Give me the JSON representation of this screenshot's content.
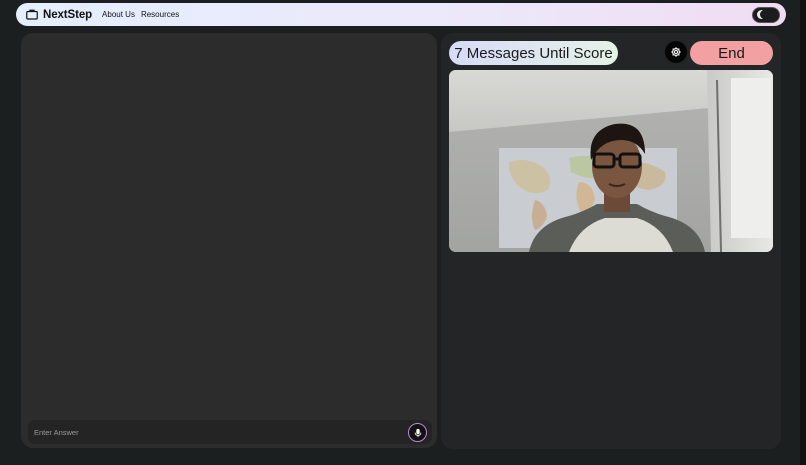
{
  "nav": {
    "brand": "NextStep",
    "brand_icon": "briefcase-icon",
    "links": [
      "About Us",
      "Resources"
    ],
    "theme_toggle_icon": "moon-icon"
  },
  "chat": {
    "input_placeholder": "Enter Answer",
    "input_value": "",
    "mic_icon": "microphone-icon"
  },
  "interview": {
    "score_text": "7 Messages Until Score",
    "settings_icon": "gear-icon",
    "end_label": "End"
  },
  "colors": {
    "background": "#1c1f20",
    "panel_left": "#2c2c2c",
    "panel_right": "#232527",
    "end_button": "#f2a0a2",
    "mic_ring": "#b78bd8"
  }
}
